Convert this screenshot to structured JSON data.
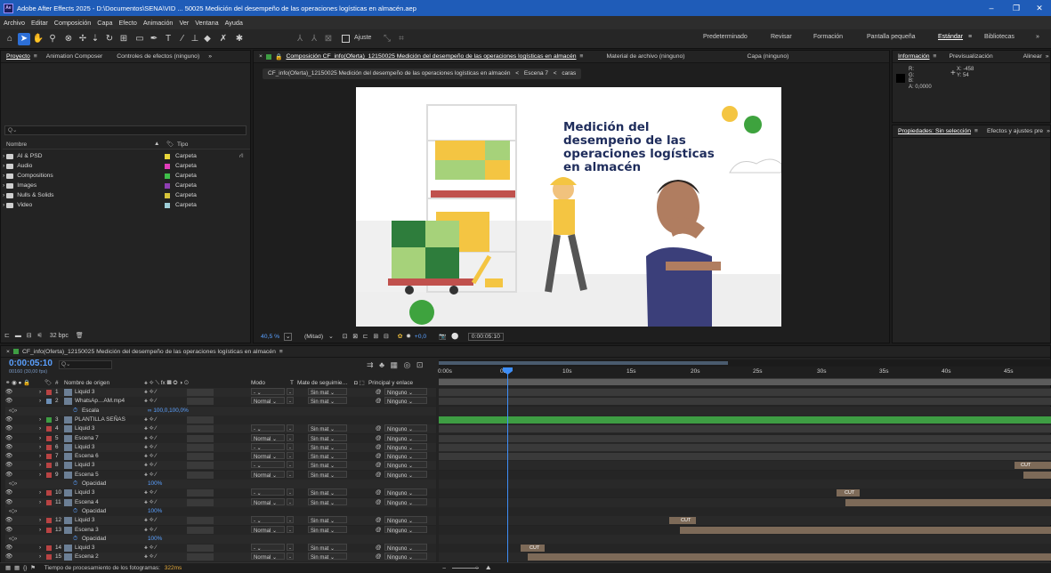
{
  "window": {
    "app_icon": "Ae",
    "title": "Adobe After Effects 2025 - D:\\Documentos\\SENA\\VID ... 50025 Medición del desempeño de las operaciones logísticas en almacén.aep",
    "minimize": "–",
    "maximize": "❐",
    "close": "✕"
  },
  "menu": [
    "Archivo",
    "Editar",
    "Composición",
    "Capa",
    "Efecto",
    "Animación",
    "Ver",
    "Ventana",
    "Ayuda"
  ],
  "toolbar": {
    "snap_label": "Ajuste",
    "workspaces": [
      "Predeterminado",
      "Revisar",
      "Formación",
      "Pantalla pequeña",
      "Estándar",
      "Bibliotecas"
    ],
    "active_workspace": "Estándar",
    "more": "»",
    "menu_icon": "≡"
  },
  "project": {
    "tabs": [
      "Proyecto",
      "Animation Composer",
      "Controles de efectos (ninguno)"
    ],
    "menu_icon": "≡",
    "more": "»",
    "search_placeholder": "Q⌄",
    "col_name": "Nombre",
    "col_type": "Tipo",
    "items": [
      {
        "name": "AI & PSD",
        "type": "Carpeta",
        "color": "#e8d63a"
      },
      {
        "name": "Audio",
        "type": "Carpeta",
        "color": "#e13dbb"
      },
      {
        "name": "Compositions",
        "type": "Carpeta",
        "color": "#3fbf4a"
      },
      {
        "name": "Images",
        "type": "Carpeta",
        "color": "#8f3fb3"
      },
      {
        "name": "Nulls & Solids",
        "type": "Carpeta",
        "color": "#d6c43a"
      },
      {
        "name": "Video",
        "type": "Carpeta",
        "color": "#9fcfd8"
      }
    ],
    "bpc": "32 bpc"
  },
  "viewer": {
    "tab_close": "×",
    "comp_tab": "Composición CF_info(Oferta)_12150025 Medición del desempeño de las operaciones logísticas en almacén",
    "footage_tab": "Material de archivo (ninguno)",
    "layer_tab": "Capa (ninguno)",
    "menu_icon": "≡",
    "breadcrumbs": [
      "CF_info(Oferta)_12150025 Medición del desempeño de las operaciones logísticas en almacén",
      "Escena 7",
      "caras"
    ],
    "bc_sep": "<",
    "zoom": "40,5 %",
    "resolution": "(Mitad)",
    "exposure": "+0,0",
    "timecode": "0:00:05:10",
    "art_title": "Medición del desempeño de las operaciones logísticas en almacén"
  },
  "info": {
    "tabs": [
      "Información",
      "Previsualización",
      "Alinear"
    ],
    "menu_icon": "≡",
    "more": "»",
    "r": "R:",
    "g": "G:",
    "b": "B:",
    "a": "A: 0,0000",
    "x": "X: -458",
    "y": "Y: 54",
    "plus": "+"
  },
  "props": {
    "tabs": [
      "Propiedades: Sin selección",
      "Efectos y ajustes pre"
    ],
    "menu_icon": "≡",
    "more": "»"
  },
  "timeline": {
    "tab": "CF_info(Oferta)_12150025 Medición del desempeño de las operaciones logísticas en almacén",
    "close": "×",
    "menu_icon": "≡",
    "timecode": "0:00:05:10",
    "fps": "00160 (30,00 fps)",
    "search": "Q⌄",
    "col_num": "#",
    "col_source": "Nombre de origen",
    "col_mode": "Modo",
    "col_t": "T",
    "col_matte": "Mate de seguimie…",
    "col_parent": "Principal y enlace",
    "ruler": [
      "0:00s",
      "05s",
      "10s",
      "15s",
      "20s",
      "25s",
      "30s",
      "35s",
      "40s",
      "45s"
    ],
    "layers": [
      {
        "n": "1",
        "name": "Liquid 3",
        "mode": "-",
        "matte": "Sin mat",
        "parent": "Ninguno",
        "color": "#b84343",
        "kind": "layer"
      },
      {
        "n": "2",
        "name": "WhatsAp…AM.mp4",
        "mode": "Normal",
        "matte": "Sin mat",
        "parent": "Ninguno",
        "color": "#6c8fb6",
        "kind": "layer"
      },
      {
        "n": "",
        "name": "Escala",
        "value": "∞ 100,0,100,0%",
        "kind": "prop"
      },
      {
        "n": "3",
        "name": "PLANTILLA SEÑAS",
        "mode": "",
        "matte": "",
        "parent": "",
        "color": "#3e9d43",
        "kind": "layer"
      },
      {
        "n": "4",
        "name": "Liquid 3",
        "mode": "-",
        "matte": "Sin mat",
        "parent": "Ninguno",
        "color": "#b84343",
        "kind": "layer"
      },
      {
        "n": "5",
        "name": "Escena 7",
        "mode": "Normal",
        "matte": "Sin mat",
        "parent": "Ninguno",
        "color": "#b84343",
        "kind": "layer"
      },
      {
        "n": "6",
        "name": "Liquid 3",
        "mode": "-",
        "matte": "Sin mat",
        "parent": "Ninguno",
        "color": "#b84343",
        "kind": "layer"
      },
      {
        "n": "7",
        "name": "Escena 6",
        "mode": "Normal",
        "matte": "Sin mat",
        "parent": "Ninguno",
        "color": "#b84343",
        "kind": "layer"
      },
      {
        "n": "8",
        "name": "Liquid 3",
        "mode": "-",
        "matte": "Sin mat",
        "parent": "Ninguno",
        "color": "#b84343",
        "kind": "layer"
      },
      {
        "n": "9",
        "name": "Escena 5",
        "mode": "Normal",
        "matte": "Sin mat",
        "parent": "Ninguno",
        "color": "#b84343",
        "kind": "layer"
      },
      {
        "n": "",
        "name": "Opacidad",
        "value": "100%",
        "kind": "prop"
      },
      {
        "n": "10",
        "name": "Liquid 3",
        "mode": "-",
        "matte": "Sin mat",
        "parent": "Ninguno",
        "color": "#b84343",
        "kind": "layer"
      },
      {
        "n": "11",
        "name": "Escena 4",
        "mode": "Normal",
        "matte": "Sin mat",
        "parent": "Ninguno",
        "color": "#b84343",
        "kind": "layer"
      },
      {
        "n": "",
        "name": "Opacidad",
        "value": "100%",
        "kind": "prop"
      },
      {
        "n": "12",
        "name": "Liquid 3",
        "mode": "-",
        "matte": "Sin mat",
        "parent": "Ninguno",
        "color": "#b84343",
        "kind": "layer"
      },
      {
        "n": "13",
        "name": "Escena 3",
        "mode": "Normal",
        "matte": "Sin mat",
        "parent": "Ninguno",
        "color": "#b84343",
        "kind": "layer"
      },
      {
        "n": "",
        "name": "Opacidad",
        "value": "100%",
        "kind": "prop"
      },
      {
        "n": "14",
        "name": "Liquid 3",
        "mode": "-",
        "matte": "Sin mat",
        "parent": "Ninguno",
        "color": "#b84343",
        "kind": "layer"
      },
      {
        "n": "15",
        "name": "Escena 2",
        "mode": "Normal",
        "matte": "Sin mat",
        "parent": "Ninguno",
        "color": "#b84343",
        "kind": "layer"
      }
    ],
    "cut_label": "CUT",
    "status": "Tiempo de procesamiento de los fotogramas:",
    "status_value": "322ms"
  }
}
